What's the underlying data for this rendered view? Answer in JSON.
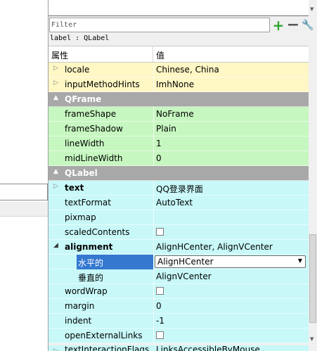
{
  "filter": {
    "placeholder": "Filter"
  },
  "toolbar": {
    "add_icon": "plus-icon",
    "remove_icon": "minus-icon",
    "configure_icon": "wrench-icon"
  },
  "object_label": "label : QLabel",
  "header": {
    "property": "属性",
    "value": "值"
  },
  "rows": [
    {
      "kind": "prop",
      "color": "yellow",
      "expander": true,
      "name": "locale",
      "value": "Chinese, China"
    },
    {
      "kind": "prop",
      "color": "yellow",
      "expander": true,
      "name": "inputMethodHints",
      "value": "ImhNone"
    },
    {
      "kind": "section",
      "name": "QFrame"
    },
    {
      "kind": "prop",
      "color": "green",
      "name": "frameShape",
      "value": "NoFrame"
    },
    {
      "kind": "prop",
      "color": "green",
      "name": "frameShadow",
      "value": "Plain"
    },
    {
      "kind": "prop",
      "color": "green",
      "name": "lineWidth",
      "value": "1"
    },
    {
      "kind": "prop",
      "color": "green",
      "name": "midLineWidth",
      "value": "0"
    },
    {
      "kind": "section",
      "name": "QLabel"
    },
    {
      "kind": "prop",
      "color": "cyan",
      "expander": true,
      "bold": true,
      "name": "text",
      "value": "QQ登录界面"
    },
    {
      "kind": "prop",
      "color": "cyan",
      "name": "textFormat",
      "value": "AutoText"
    },
    {
      "kind": "prop",
      "color": "cyan",
      "name": "pixmap",
      "value": ""
    },
    {
      "kind": "checkbox",
      "color": "cyan",
      "name": "scaledContents",
      "checked": false
    },
    {
      "kind": "prop",
      "color": "cyan",
      "expander": "open",
      "bold": true,
      "name": "alignment",
      "value": "AlignHCenter, AlignVCenter"
    },
    {
      "kind": "combo",
      "color": "cyan",
      "sub": true,
      "selected": true,
      "name": "水平的",
      "value": "AlignHCenter"
    },
    {
      "kind": "prop",
      "color": "cyan",
      "sub": true,
      "name": "垂直的",
      "value": "AlignVCenter"
    },
    {
      "kind": "checkbox",
      "color": "cyan",
      "name": "wordWrap",
      "checked": false
    },
    {
      "kind": "prop",
      "color": "cyan",
      "name": "margin",
      "value": "0"
    },
    {
      "kind": "prop",
      "color": "cyan",
      "name": "indent",
      "value": "-1"
    },
    {
      "kind": "checkbox",
      "color": "cyan",
      "name": "openExternalLinks",
      "checked": false
    }
  ],
  "partial_row": {
    "name": "textInteractionFlags",
    "value": "LinksAccessibleByMouse"
  }
}
